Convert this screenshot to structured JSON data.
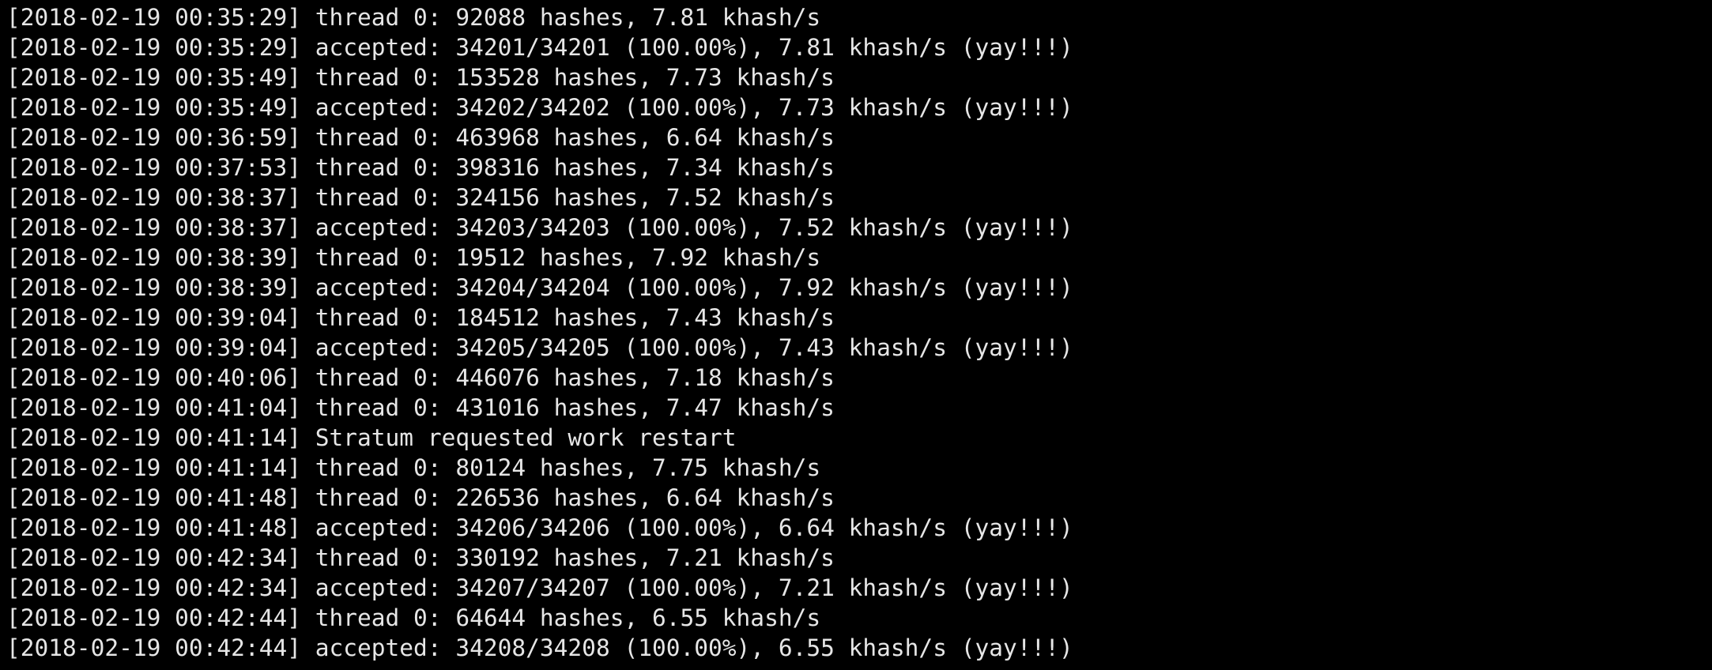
{
  "terminal": {
    "background": "#000000",
    "foreground": "#e6e6e6",
    "lines": [
      "[2018-02-19 00:35:29] thread 0: 92088 hashes, 7.81 khash/s",
      "[2018-02-19 00:35:29] accepted: 34201/34201 (100.00%), 7.81 khash/s (yay!!!)",
      "[2018-02-19 00:35:49] thread 0: 153528 hashes, 7.73 khash/s",
      "[2018-02-19 00:35:49] accepted: 34202/34202 (100.00%), 7.73 khash/s (yay!!!)",
      "[2018-02-19 00:36:59] thread 0: 463968 hashes, 6.64 khash/s",
      "[2018-02-19 00:37:53] thread 0: 398316 hashes, 7.34 khash/s",
      "[2018-02-19 00:38:37] thread 0: 324156 hashes, 7.52 khash/s",
      "[2018-02-19 00:38:37] accepted: 34203/34203 (100.00%), 7.52 khash/s (yay!!!)",
      "[2018-02-19 00:38:39] thread 0: 19512 hashes, 7.92 khash/s",
      "[2018-02-19 00:38:39] accepted: 34204/34204 (100.00%), 7.92 khash/s (yay!!!)",
      "[2018-02-19 00:39:04] thread 0: 184512 hashes, 7.43 khash/s",
      "[2018-02-19 00:39:04] accepted: 34205/34205 (100.00%), 7.43 khash/s (yay!!!)",
      "[2018-02-19 00:40:06] thread 0: 446076 hashes, 7.18 khash/s",
      "[2018-02-19 00:41:04] thread 0: 431016 hashes, 7.47 khash/s",
      "[2018-02-19 00:41:14] Stratum requested work restart",
      "[2018-02-19 00:41:14] thread 0: 80124 hashes, 7.75 khash/s",
      "[2018-02-19 00:41:48] thread 0: 226536 hashes, 6.64 khash/s",
      "[2018-02-19 00:41:48] accepted: 34206/34206 (100.00%), 6.64 khash/s (yay!!!)",
      "[2018-02-19 00:42:34] thread 0: 330192 hashes, 7.21 khash/s",
      "[2018-02-19 00:42:34] accepted: 34207/34207 (100.00%), 7.21 khash/s (yay!!!)",
      "[2018-02-19 00:42:44] thread 0: 64644 hashes, 6.55 khash/s",
      "[2018-02-19 00:42:44] accepted: 34208/34208 (100.00%), 6.55 khash/s (yay!!!)"
    ]
  }
}
